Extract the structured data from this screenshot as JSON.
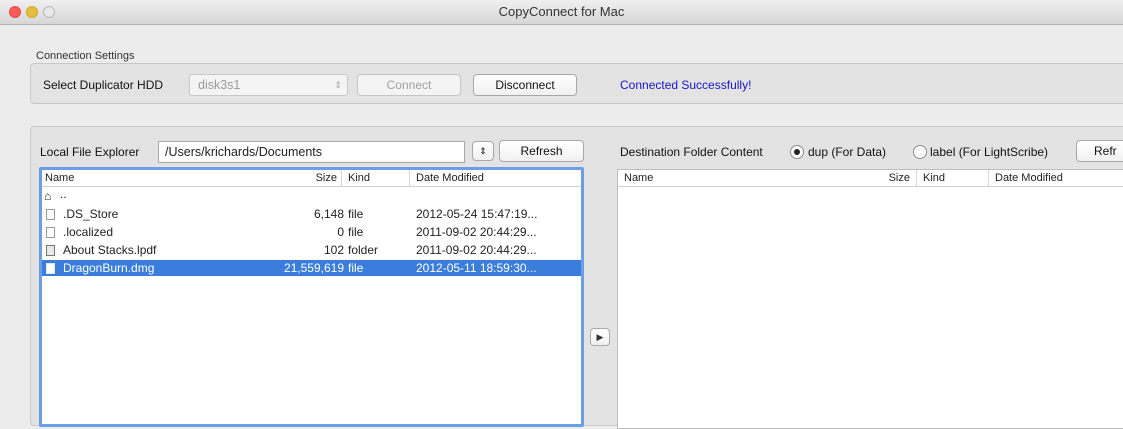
{
  "window": {
    "title": "CopyConnect for Mac"
  },
  "connection": {
    "group_label": "Connection Settings",
    "select_label": "Select Duplicator HDD",
    "selected_disk": "disk3s1",
    "connect_label": "Connect",
    "disconnect_label": "Disconnect",
    "status": "Connected Successfully!",
    "status_color": "#1a14c8"
  },
  "local": {
    "label": "Local File Explorer",
    "path": "/Users/krichards/Documents",
    "refresh_label": "Refresh",
    "columns": {
      "name": "Name",
      "size": "Size",
      "kind": "Kind",
      "date": "Date Modified"
    },
    "parent": "..",
    "rows": [
      {
        "name": ".DS_Store",
        "size": "6,148",
        "kind": "file",
        "date": "2012-05-24 15:47:19...",
        "icon": "document-icon"
      },
      {
        "name": ".localized",
        "size": "0",
        "kind": "file",
        "date": "2011-09-02 20:44:29...",
        "icon": "document-icon"
      },
      {
        "name": "About Stacks.lpdf",
        "size": "102",
        "kind": "folder",
        "date": "2011-09-02 20:44:29...",
        "icon": "pdf-bundle-icon"
      },
      {
        "name": "DragonBurn.dmg",
        "size": "21,559,619",
        "kind": "file",
        "date": "2012-05-11 18:59:30...",
        "icon": "document-icon",
        "selected": true
      }
    ]
  },
  "destination": {
    "label": "Destination Folder Content",
    "radio_dup": "dup (For Data)",
    "radio_label": "label (For LightScribe)",
    "refresh_label": "Refr",
    "columns": {
      "name": "Name",
      "size": "Size",
      "kind": "Kind",
      "date": "Date Modified"
    }
  },
  "transfer": {
    "icon": "play-arrow-icon"
  },
  "colors": {
    "selection": "#3b7ddb",
    "focus_border": "#6a9ee8"
  }
}
